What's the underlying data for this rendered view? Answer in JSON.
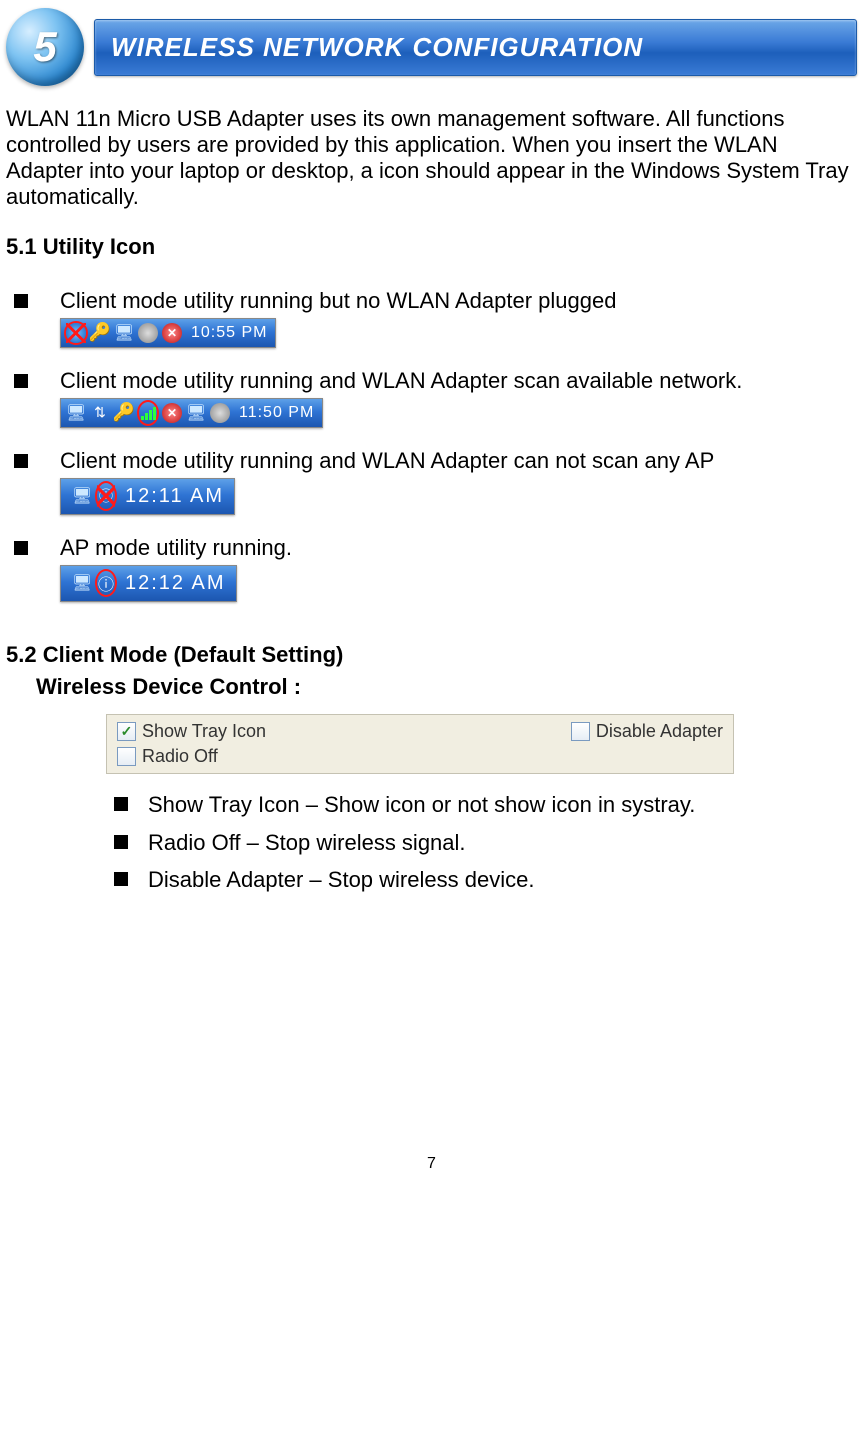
{
  "header": {
    "step_number": "5",
    "title": "WIRELESS NETWORK CONFIGURATION"
  },
  "intro": "WLAN 11n Micro USB Adapter uses its own management software. All functions controlled by users are provided by this application. When you insert the WLAN Adapter into your laptop or desktop, a icon should appear in the Windows System Tray automatically.",
  "section_5_1": {
    "heading": "5.1 Utility Icon",
    "items": [
      {
        "text": "Client mode utility running but no WLAN Adapter plugged",
        "tray_time": "10:55 PM"
      },
      {
        "text": "Client mode utility running and WLAN Adapter scan available network.",
        "tray_time": "11:50 PM"
      },
      {
        "text": "Client mode utility running and WLAN Adapter can not scan any AP",
        "tray_time": "12:11 AM"
      },
      {
        "text": "AP mode utility running.",
        "tray_time": "12:12 AM"
      }
    ]
  },
  "section_5_2": {
    "heading": "5.2 Client Mode (Default Setting)",
    "subheading": "Wireless Device Control :",
    "checkboxes": {
      "show_tray_icon": {
        "label": "Show Tray Icon",
        "checked": true
      },
      "disable_adapter": {
        "label": "Disable Adapter",
        "checked": false
      },
      "radio_off": {
        "label": "Radio Off",
        "checked": false
      }
    },
    "bullets": [
      "Show Tray Icon – Show icon or not show icon in systray.",
      "Radio Off – Stop wireless signal.",
      "Disable Adapter – Stop wireless device."
    ]
  },
  "page_number": "7"
}
